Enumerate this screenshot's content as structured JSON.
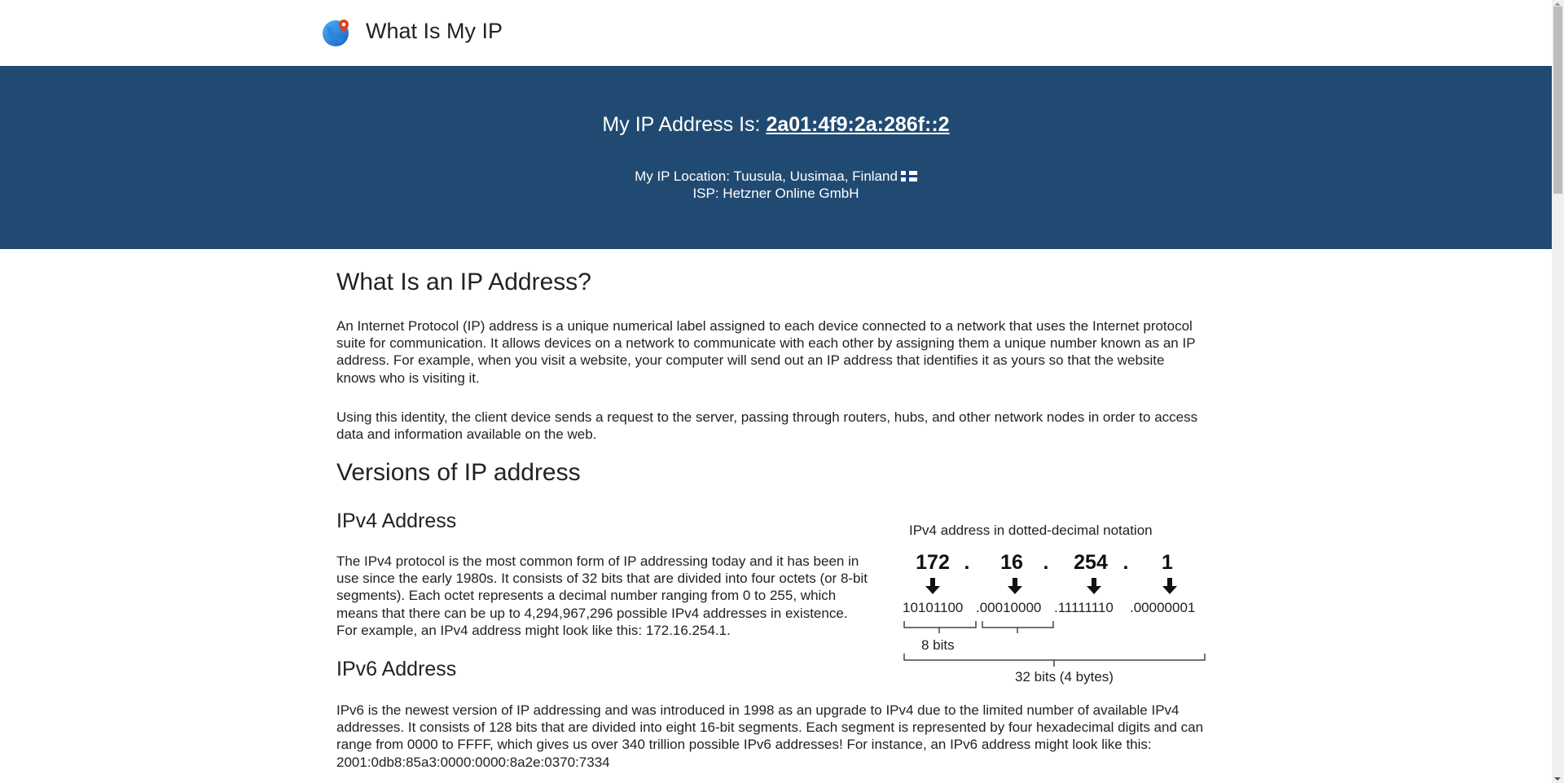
{
  "header": {
    "site_title": "What Is My IP",
    "logo_icon": "globe-location-icon"
  },
  "hero": {
    "ip_label": "My IP Address Is:",
    "ip_value": "2a01:4f9:2a:286f::2",
    "location_label": "My IP Location: Tuusula, Uusimaa, Finland",
    "flag_icon": "finland-flag-icon",
    "isp_label": "ISP: Hetzner Online GmbH",
    "background_color": "#214a72"
  },
  "main": {
    "section1": {
      "title": "What Is an IP Address?",
      "paragraphs": [
        "An Internet Protocol (IP) address is a unique numerical label assigned to each device connected to a network that uses the Internet protocol suite for communication. It allows devices on a network to communicate with each other by assigning them a unique number known as an IP address. For example, when you visit a website, your computer will send out an IP address that identifies it as yours so that the website knows who is visiting it.",
        "Using this identity, the client device sends a request to the server, passing through routers, hubs, and other network nodes in order to access data and information available on the web."
      ]
    },
    "section2": {
      "title": "Versions of IP address",
      "ipv4": {
        "title": "IPv4 Address",
        "text": "The IPv4 protocol is the most common form of IP addressing today and it has been in use since the early 1980s. It consists of 32 bits that are divided into four octets (or 8-bit segments). Each octet represents a decimal number ranging from 0 to 255, which means that there can be up to 4,294,967,296 possible IPv4 addresses in existence. For example, an IPv4 address might look like this: 172.16.254.1."
      },
      "ipv6": {
        "title": "IPv6 Address",
        "text": "IPv6 is the newest version of IP addressing and was introduced in 1998 as an upgrade to IPv4 due to the limited number of available IPv4 addresses. It consists of 128 bits that are divided into eight 16-bit segments. Each segment is represented by four hexadecimal digits and can range from 0000 to FFFF, which gives us over 340 trillion possible IPv6 addresses! For instance, an IPv6 address might look like this: 2001:0db8:85a3:0000:0000:8a2e:0370:7334"
      }
    },
    "diagram": {
      "title": "IPv4 address in dotted-decimal notation",
      "octets": [
        "172",
        "16",
        "254",
        "1"
      ],
      "dot": ".",
      "binary": [
        "10101100",
        ".00010000",
        ".11111110",
        ".00000001"
      ],
      "octet_label": "8 bits",
      "total_label": "32 bits (4 bytes)"
    }
  }
}
